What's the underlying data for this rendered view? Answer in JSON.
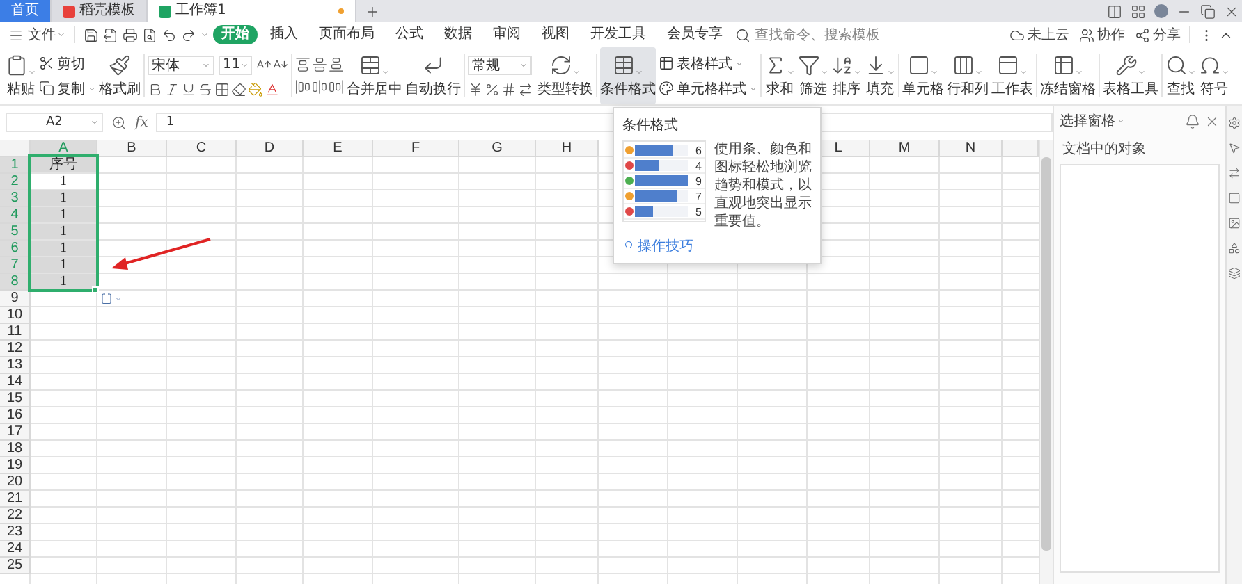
{
  "tabs": [
    {
      "kind": "home",
      "label": "首页",
      "selected": false,
      "unsaved": false
    },
    {
      "kind": "docer",
      "label": "稻壳模板",
      "selected": false,
      "unsaved": false
    },
    {
      "kind": "sheet",
      "label": "工作簿1",
      "selected": true,
      "unsaved": true
    }
  ],
  "menu": {
    "file": "文件",
    "tabs": [
      {
        "label": "开始",
        "selected": true
      },
      {
        "label": "插入",
        "selected": false
      },
      {
        "label": "页面布局",
        "selected": false
      },
      {
        "label": "公式",
        "selected": false
      },
      {
        "label": "数据",
        "selected": false
      },
      {
        "label": "审阅",
        "selected": false
      },
      {
        "label": "视图",
        "selected": false
      },
      {
        "label": "开发工具",
        "selected": false
      },
      {
        "label": "会员专享",
        "selected": false
      }
    ],
    "search": {
      "placeholder": "查找命令、搜索模板"
    },
    "actions": [
      "未上云",
      "协作",
      "分享"
    ]
  },
  "ribbon": {
    "groups": [
      {
        "items": [
          {
            "kind": "big",
            "label": "粘贴",
            "dropdown": true,
            "selected": false
          },
          {
            "kind": "stack",
            "items": [
              {
                "label": "剪切",
                "dropdown": false
              },
              {
                "label": "复制",
                "dropdown": true
              }
            ]
          },
          {
            "kind": "big",
            "label": "格式刷",
            "dropdown": false,
            "selected": false
          }
        ]
      },
      {
        "items": [
          {
            "kind": "font",
            "font": "宋体",
            "size": "11"
          }
        ]
      },
      {
        "items": [
          {
            "kind": "align"
          },
          {
            "kind": "big",
            "label": "合并居中",
            "dropdown": true,
            "selected": false
          },
          {
            "kind": "big",
            "label": "自动换行",
            "dropdown": false,
            "selected": false
          }
        ]
      },
      {
        "items": [
          {
            "kind": "number",
            "format": "常规"
          },
          {
            "kind": "big",
            "label": "类型转换",
            "dropdown": true,
            "selected": false
          }
        ]
      },
      {
        "items": [
          {
            "kind": "big",
            "label": "条件格式",
            "dropdown": true,
            "selected": true
          },
          {
            "kind": "stack",
            "items": [
              {
                "label": "表格样式",
                "dropdown": true
              },
              {
                "label": "单元格样式",
                "dropdown": true
              }
            ]
          }
        ]
      },
      {
        "items": [
          {
            "kind": "big",
            "label": "求和",
            "dropdown": true,
            "selected": false
          },
          {
            "kind": "big",
            "label": "筛选",
            "dropdown": true,
            "selected": false
          },
          {
            "kind": "big",
            "label": "排序",
            "dropdown": true,
            "selected": false
          },
          {
            "kind": "big",
            "label": "填充",
            "dropdown": true,
            "selected": false
          }
        ]
      },
      {
        "items": [
          {
            "kind": "big",
            "label": "单元格",
            "dropdown": true,
            "selected": false
          },
          {
            "kind": "big",
            "label": "行和列",
            "dropdown": true,
            "selected": false
          },
          {
            "kind": "big",
            "label": "工作表",
            "dropdown": true,
            "selected": false
          }
        ]
      },
      {
        "items": [
          {
            "kind": "big",
            "label": "冻结窗格",
            "dropdown": true,
            "selected": false
          }
        ]
      },
      {
        "items": [
          {
            "kind": "big",
            "label": "表格工具",
            "dropdown": true,
            "selected": false
          }
        ]
      },
      {
        "items": [
          {
            "kind": "big",
            "label": "查找",
            "dropdown": true,
            "selected": false
          },
          {
            "kind": "big",
            "label": "符号",
            "dropdown": true,
            "selected": false
          }
        ]
      }
    ]
  },
  "formula_bar": {
    "name_box": "A2",
    "function_label": "fx",
    "value": "1"
  },
  "sheet": {
    "columns": [
      {
        "label": "A",
        "selected": true
      },
      {
        "label": "B",
        "selected": false
      },
      {
        "label": "C",
        "selected": false
      },
      {
        "label": "D",
        "selected": false
      },
      {
        "label": "E",
        "selected": false
      },
      {
        "label": "F",
        "selected": false
      },
      {
        "label": "G",
        "selected": false
      },
      {
        "label": "H",
        "selected": false
      },
      {
        "label": "L",
        "selected": false
      },
      {
        "label": "M",
        "selected": false
      },
      {
        "label": "N",
        "selected": false
      }
    ],
    "rows": [
      {
        "label": "1",
        "selected": true,
        "cells": [
          {
            "text": "序号",
            "selected": true,
            "active": false
          }
        ]
      },
      {
        "label": "2",
        "selected": true,
        "cells": [
          {
            "text": "1",
            "selected": true,
            "active": true
          }
        ]
      },
      {
        "label": "3",
        "selected": true,
        "cells": [
          {
            "text": "1",
            "selected": true,
            "active": false
          }
        ]
      },
      {
        "label": "4",
        "selected": true,
        "cells": [
          {
            "text": "1",
            "selected": true,
            "active": false
          }
        ]
      },
      {
        "label": "5",
        "selected": true,
        "cells": [
          {
            "text": "1",
            "selected": true,
            "active": false
          }
        ]
      },
      {
        "label": "6",
        "selected": true,
        "cells": [
          {
            "text": "1",
            "selected": true,
            "active": false
          }
        ]
      },
      {
        "label": "7",
        "selected": true,
        "cells": [
          {
            "text": "1",
            "selected": true,
            "active": false
          }
        ]
      },
      {
        "label": "8",
        "selected": true,
        "cells": [
          {
            "text": "1",
            "selected": true,
            "active": false
          }
        ]
      },
      {
        "label": "9",
        "selected": false
      },
      {
        "label": "10",
        "selected": false
      },
      {
        "label": "11",
        "selected": false
      },
      {
        "label": "12",
        "selected": false
      },
      {
        "label": "13",
        "selected": false
      },
      {
        "label": "14",
        "selected": false
      },
      {
        "label": "15",
        "selected": false
      },
      {
        "label": "16",
        "selected": false
      },
      {
        "label": "17",
        "selected": false
      },
      {
        "label": "18",
        "selected": false
      },
      {
        "label": "19",
        "selected": false
      },
      {
        "label": "20",
        "selected": false
      },
      {
        "label": "21",
        "selected": false
      },
      {
        "label": "22",
        "selected": false
      },
      {
        "label": "23",
        "selected": false
      },
      {
        "label": "24",
        "selected": false
      },
      {
        "label": "25",
        "selected": false
      }
    ]
  },
  "tooltip": {
    "title": "条件格式",
    "preview": [
      {
        "value": "6",
        "level": 0.7,
        "color": "#f0a030"
      },
      {
        "value": "4",
        "level": 0.45,
        "color": "#e04848"
      },
      {
        "value": "9",
        "level": 1,
        "color": "#4caf50"
      },
      {
        "value": "7",
        "level": 0.8,
        "color": "#f0a030"
      },
      {
        "value": "5",
        "level": 0.35,
        "color": "#e04848"
      }
    ],
    "description": "使用条、颜色和图标轻松地浏览趋势和模式，以直观地突出显示重要值。",
    "link": "操作技巧"
  },
  "selection_pane": {
    "title": "选择窗格",
    "label": "文档中的对象"
  }
}
